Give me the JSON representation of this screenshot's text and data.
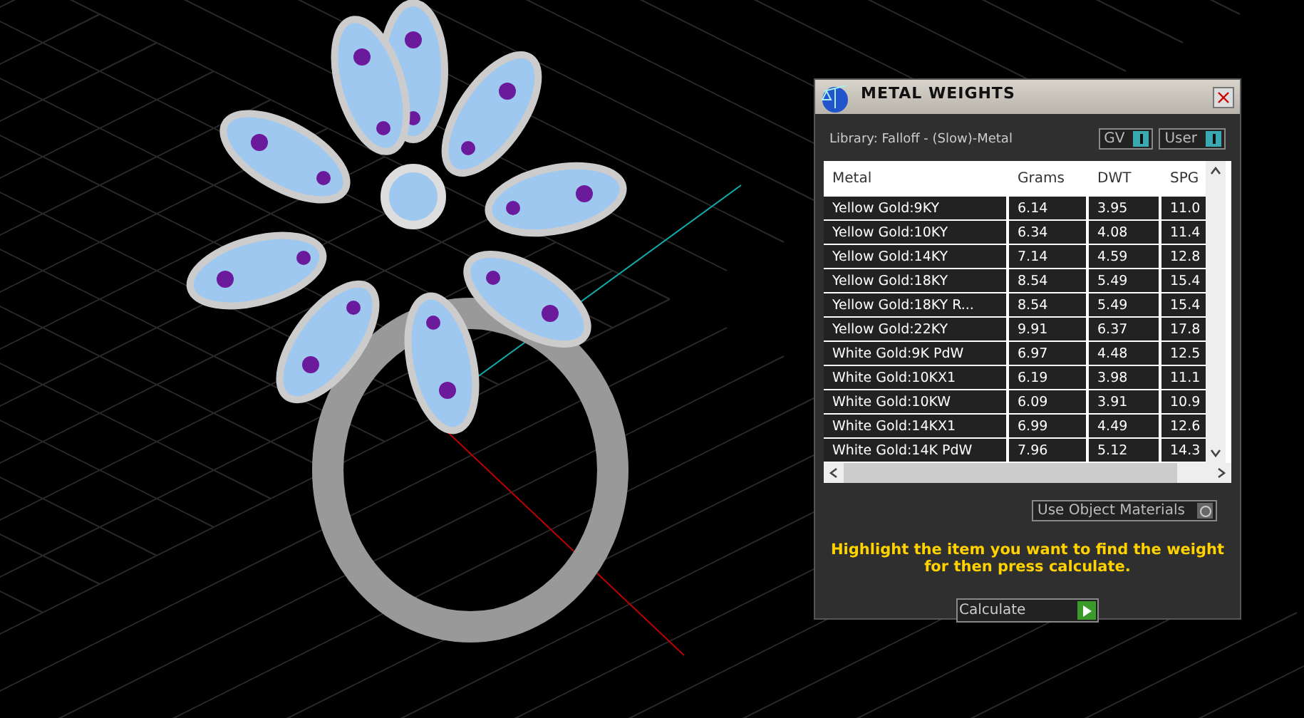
{
  "window": {
    "title": "METAL WEIGHTS",
    "library": "Library: Falloff - (Slow)-Metal"
  },
  "toggles": [
    {
      "label": "GV",
      "on": true
    },
    {
      "label": "User",
      "on": true
    }
  ],
  "table": {
    "columns": [
      "Metal",
      "Grams",
      "DWT",
      "SPG"
    ],
    "rows": [
      [
        "Yellow Gold:9KY",
        "6.14",
        "3.95",
        "11.0"
      ],
      [
        "Yellow Gold:10KY",
        "6.34",
        "4.08",
        "11.4"
      ],
      [
        "Yellow Gold:14KY",
        "7.14",
        "4.59",
        "12.8"
      ],
      [
        "Yellow Gold:18KY",
        "8.54",
        "5.49",
        "15.4"
      ],
      [
        "Yellow Gold:18KY R...",
        "8.54",
        "5.49",
        "15.4"
      ],
      [
        "Yellow Gold:22KY",
        "9.91",
        "6.37",
        "17.8"
      ],
      [
        "White Gold:9K PdW",
        "6.97",
        "4.48",
        "12.5"
      ],
      [
        "White Gold:10KX1",
        "6.19",
        "3.98",
        "11.1"
      ],
      [
        "White Gold:10KW",
        "6.09",
        "3.91",
        "10.9"
      ],
      [
        "White Gold:14KX1",
        "6.99",
        "4.49",
        "12.6"
      ],
      [
        "White Gold:14K PdW",
        "7.96",
        "5.12",
        "14.3"
      ]
    ]
  },
  "use_object_materials": {
    "label": "Use Object Materials",
    "on": false
  },
  "hint": "Highlight the item you want to find the weight for then press calculate.",
  "calculate_button": "Calculate"
}
